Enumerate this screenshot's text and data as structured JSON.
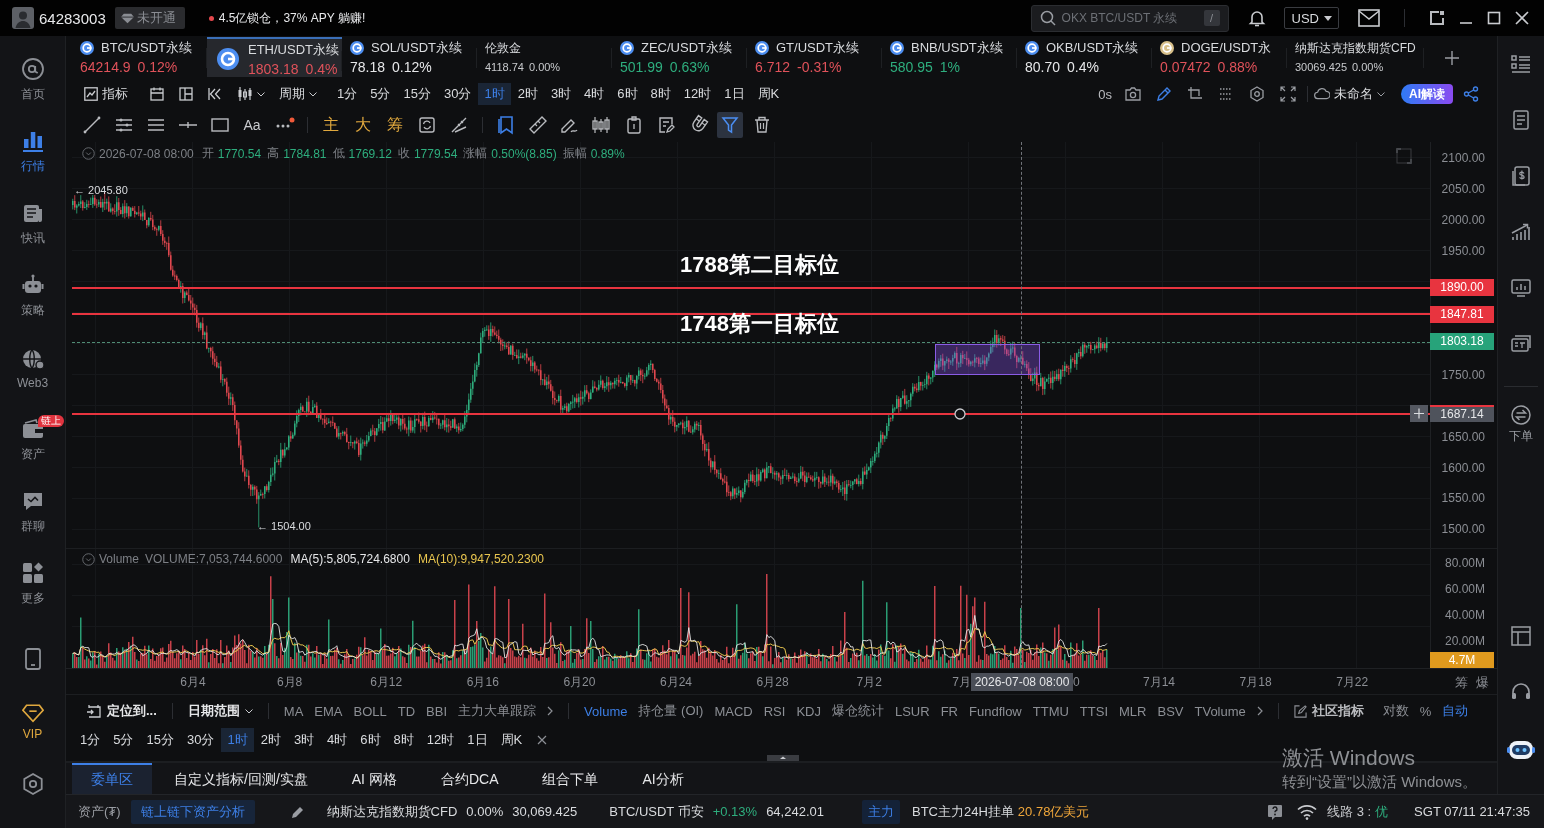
{
  "top_bar": {
    "user_id": "64283003",
    "membership": "未开通",
    "promo": "4.5亿锁仓，37% APY 躺赚!",
    "search": {
      "placeholder": "OKX BTC/USDT 永续",
      "shortcut": "/"
    },
    "currency": "USD"
  },
  "sidebar": {
    "items": [
      {
        "label": "首页",
        "kind": "nav",
        "selected": false
      },
      {
        "label": "行情",
        "kind": "nav",
        "selected": true
      },
      {
        "label": "快讯",
        "kind": "nav",
        "selected": false
      },
      {
        "label": "策略",
        "kind": "nav",
        "selected": false
      },
      {
        "label": "Web3",
        "kind": "nav",
        "selected": false
      },
      {
        "label": "资产",
        "kind": "nav",
        "selected": false,
        "badge": "链上"
      },
      {
        "label": "群聊",
        "kind": "nav",
        "selected": false
      },
      {
        "label": "更多",
        "kind": "nav",
        "selected": false
      },
      {
        "label": "VIP",
        "kind": "vip",
        "selected": false
      }
    ]
  },
  "tickers": [
    {
      "name": "BTC/USDT永续",
      "price": "64214.9",
      "change": "0.12%",
      "kind": "coin",
      "icon": {
        "color": "#4d8ef0"
      },
      "color": "#e0525a",
      "selected": false
    },
    {
      "name": "ETH/USDT永续",
      "price": "1803.18",
      "change": "0.4%",
      "kind": "coin",
      "icon": {
        "color": "#4d8ef0"
      },
      "color": "#e0525a",
      "selected": true
    },
    {
      "name": "SOL/USDT永续",
      "price": "78.18",
      "change": "0.12%",
      "kind": "coin",
      "icon": {
        "color": "#4d8ef0"
      },
      "color": "#e6e7e9",
      "selected": false
    },
    {
      "name": "伦敦金",
      "price": "4118.74",
      "change": "0.00%",
      "kind": "index",
      "color": "#c8cacd",
      "selected": false
    },
    {
      "name": "ZEC/USDT永续",
      "price": "501.99",
      "change": "0.63%",
      "kind": "coin",
      "icon": {
        "color": "#4d8ef0"
      },
      "color": "#2eae7e",
      "selected": false
    },
    {
      "name": "GT/USDT永续",
      "price": "6.712",
      "change": "-0.31%",
      "kind": "coin",
      "icon": {
        "color": "#4d8ef0"
      },
      "color": "#e0525a",
      "selected": false
    },
    {
      "name": "BNB/USDT永续",
      "price": "580.95",
      "change": "1%",
      "kind": "coin",
      "icon": {
        "color": "#4d8ef0"
      },
      "color": "#2eae7e",
      "selected": false
    },
    {
      "name": "OKB/USDT永续",
      "price": "80.70",
      "change": "0.4%",
      "kind": "coin",
      "icon": {
        "color": "#4d8ef0"
      },
      "color": "#e6e7e9",
      "selected": false
    },
    {
      "name": "DOGE/USDT永",
      "price": "0.07472",
      "change": "0.88%",
      "kind": "coin",
      "icon": {
        "color": "#d8c08a"
      },
      "color": "#e0525a",
      "selected": false
    },
    {
      "name": "纳斯达克指数期货CFD",
      "price": "30069.425",
      "change": "0.00%",
      "kind": "index",
      "color": "#c8cacd",
      "selected": false
    }
  ],
  "toolbar": {
    "indicator": "指标",
    "period": "周期",
    "timeframes": [
      {
        "label": "1分",
        "selected": false
      },
      {
        "label": "5分",
        "selected": false
      },
      {
        "label": "15分",
        "selected": false
      },
      {
        "label": "30分",
        "selected": false
      },
      {
        "label": "1时",
        "selected": true
      },
      {
        "label": "2时",
        "selected": false
      },
      {
        "label": "3时",
        "selected": false
      },
      {
        "label": "4时",
        "selected": false
      },
      {
        "label": "6时",
        "selected": false
      },
      {
        "label": "8时",
        "selected": false
      },
      {
        "label": "12时",
        "selected": false
      },
      {
        "label": "1日",
        "selected": false
      },
      {
        "label": "周K",
        "selected": false
      }
    ],
    "countdown": "0s",
    "layout_name": "未命名",
    "ai_button": "AI解读"
  },
  "drawing_tools": {
    "text_tool": "Aa",
    "chip_tools": [
      "主",
      "大",
      "筹"
    ],
    "filter_selected": true
  },
  "ohlc_header": {
    "date": "2026-07-08 08:00",
    "fields": [
      {
        "label": "开",
        "value": "1770.54"
      },
      {
        "label": "高",
        "value": "1784.81"
      },
      {
        "label": "低",
        "value": "1769.12"
      },
      {
        "label": "收",
        "value": "1779.54"
      },
      {
        "label": "涨幅",
        "value": "0.50%(8.85)"
      },
      {
        "label": "振幅",
        "value": "0.89%"
      }
    ]
  },
  "price_chart": {
    "yticks": [
      "2100.00",
      "2050.00",
      "2000.00",
      "1950.00",
      "1750.00",
      "1650.00",
      "1600.00",
      "1550.00",
      "1500.00"
    ],
    "high_label": "← 2045.80",
    "low_label": "← 1504.00",
    "annotations": [
      "1788第二目标位",
      "1748第一目标位"
    ],
    "price_tags": [
      {
        "value": "1890.00",
        "kind": "alert"
      },
      {
        "value": "1847.81",
        "kind": "alert"
      },
      {
        "value": "1803.18",
        "kind": "last"
      },
      {
        "value": "1687.14",
        "kind": "drawn"
      }
    ]
  },
  "volume_pane": {
    "title": "Volume",
    "volume": "VOLUME:7,053,744.6000",
    "ma5": "MA(5):5,805,724.6800",
    "ma10": "MA(10):9,947,520.2300",
    "yticks": [
      "80.00M",
      "60.00M",
      "40.00M",
      "20.00M"
    ],
    "last_tag": "4.7M"
  },
  "x_axis": {
    "labels": [
      {
        "text": "6月4",
        "kind": "tick"
      },
      {
        "text": "6月8",
        "kind": "tick"
      },
      {
        "text": "6月12",
        "kind": "tick"
      },
      {
        "text": "6月16",
        "kind": "tick"
      },
      {
        "text": "6月20",
        "kind": "tick"
      },
      {
        "text": "6月24",
        "kind": "tick"
      },
      {
        "text": "6月28",
        "kind": "tick"
      },
      {
        "text": "7月2",
        "kind": "tick"
      },
      {
        "text": "7月",
        "kind": "clipped_left"
      },
      {
        "text": "0",
        "kind": "clipped_right"
      },
      {
        "text": "7月14",
        "kind": "tick"
      },
      {
        "text": "7月18",
        "kind": "tick"
      },
      {
        "text": "7月22",
        "kind": "tick"
      }
    ],
    "crosshair_label": "2026-07-08 08:00",
    "corner_buttons": [
      "筹",
      "爆"
    ]
  },
  "indicator_bar": {
    "locate": "定位到...",
    "date_range": "日期范围",
    "main_indicators": [
      "MA",
      "EMA",
      "BOLL",
      "TD",
      "BBI",
      "主力大单跟踪"
    ],
    "sub_indicators": [
      {
        "label": "Volume",
        "selected": true
      },
      {
        "label": "持仓量 (OI)",
        "selected": false
      },
      {
        "label": "MACD",
        "selected": false
      },
      {
        "label": "RSI",
        "selected": false
      },
      {
        "label": "KDJ",
        "selected": false
      },
      {
        "label": "爆仓统计",
        "selected": false
      },
      {
        "label": "LSUR",
        "selected": false
      },
      {
        "label": "FR",
        "selected": false
      },
      {
        "label": "Fundflow",
        "selected": false
      },
      {
        "label": "TTMU",
        "selected": false
      },
      {
        "label": "TTSI",
        "selected": false
      },
      {
        "label": "MLR",
        "selected": false
      },
      {
        "label": "BSV",
        "selected": false
      },
      {
        "label": "TVolume",
        "selected": false
      }
    ],
    "community": "社区指标",
    "scale_options": [
      {
        "label": "对数",
        "selected": false
      },
      {
        "label": "%",
        "selected": false
      },
      {
        "label": "自动",
        "selected": true
      }
    ]
  },
  "bottom_timeframes": [
    {
      "label": "1分",
      "selected": false
    },
    {
      "label": "5分",
      "selected": false
    },
    {
      "label": "15分",
      "selected": false
    },
    {
      "label": "30分",
      "selected": false
    },
    {
      "label": "1时",
      "selected": true
    },
    {
      "label": "2时",
      "selected": false
    },
    {
      "label": "3时",
      "selected": false
    },
    {
      "label": "4时",
      "selected": false
    },
    {
      "label": "6时",
      "selected": false
    },
    {
      "label": "8时",
      "selected": false
    },
    {
      "label": "12时",
      "selected": false
    },
    {
      "label": "1日",
      "selected": false
    },
    {
      "label": "周K",
      "selected": false
    }
  ],
  "bottom_tabs": [
    {
      "label": "委单区",
      "selected": true
    },
    {
      "label": "自定义指标/回测/实盘",
      "selected": false
    },
    {
      "label": "AI 网格",
      "selected": false
    },
    {
      "label": "合约DCA",
      "selected": false
    },
    {
      "label": "组合下单",
      "selected": false
    },
    {
      "label": "AI分析",
      "selected": false
    }
  ],
  "status_bar": {
    "assets_label": "资产(₮)",
    "analysis_button": "链上链下资产分析",
    "quotes": [
      {
        "name": "纳斯达克指数期货CFD",
        "change": "0.00%",
        "price": "30,069.425",
        "color": "#d9dbde"
      },
      {
        "name": "BTC/USDT 币安",
        "change": "+0.13%",
        "price": "64,242.01",
        "color": "#2eae7e"
      }
    ],
    "main_badge": "主力",
    "order_text": "BTC主力24H挂单",
    "order_amount": "20.78亿美元",
    "route": "线路 3 :",
    "route_quality": "优",
    "clock": "SGT 07/11 21:47:35"
  },
  "right_sidebar": {
    "order_label": "下单"
  },
  "os_overlay": {
    "title": "激活 Windows",
    "message": "转到“设置”以激活 Windows。"
  }
}
